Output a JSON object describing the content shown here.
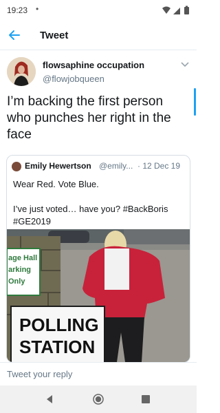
{
  "status_bar": {
    "time": "19:23",
    "dot": "•",
    "icons": [
      "wifi-icon",
      "signal-icon",
      "battery-icon"
    ]
  },
  "toolbar": {
    "back_icon": "arrow-left-icon",
    "title": "Tweet"
  },
  "tweet": {
    "author_name": "flowsaphine occupation",
    "author_handle": "@flowjobqueen",
    "text": "I’m backing the first person who punches her right in the face",
    "menu_icon": "chevron-down-icon"
  },
  "quoted_tweet": {
    "author_name": "Emily Hewertson",
    "author_handle": "@emily...",
    "date": "· 12 Dec 19",
    "line1": "Wear Red. Vote Blue.",
    "line2": "I’ve just voted… have you? #BackBoris",
    "line3": "#GE2019",
    "sign_small": [
      "age Hall",
      "arking",
      "Only"
    ],
    "sign_big": [
      "POLLING",
      "STATION"
    ]
  },
  "reply": {
    "placeholder": "Tweet your reply"
  },
  "nav_bar": {
    "icons": [
      "nav-back-icon",
      "nav-home-icon",
      "nav-recents-icon"
    ]
  },
  "colors": {
    "accent": "#1da1f2",
    "text": "#14171a",
    "secondary_text": "#657786",
    "border": "#e6ecf0",
    "coat": "#c8223a"
  }
}
